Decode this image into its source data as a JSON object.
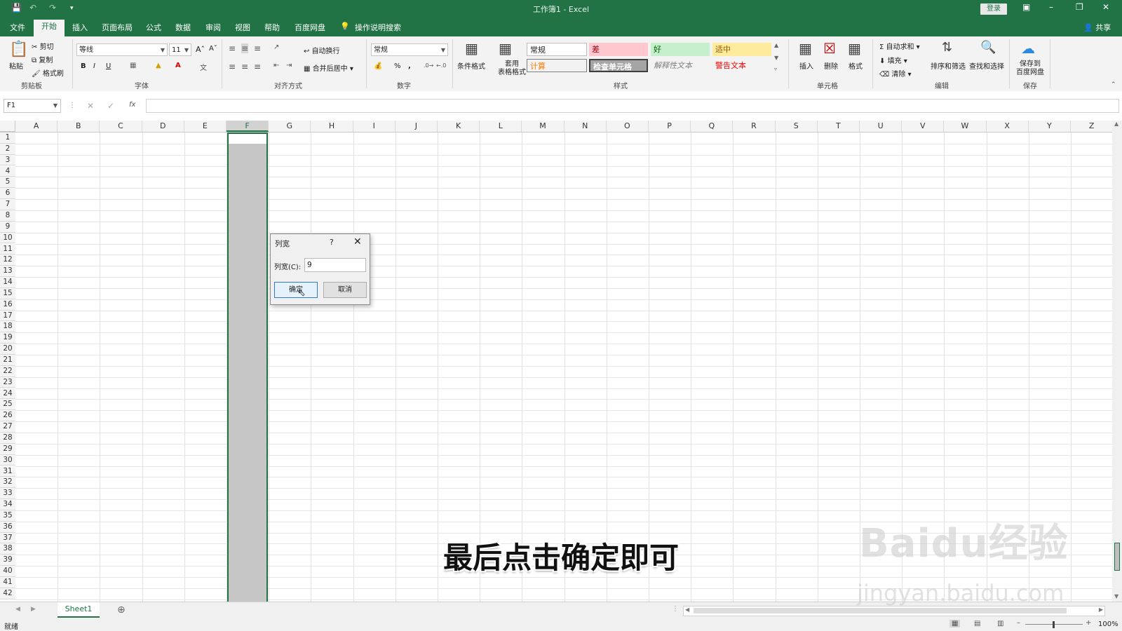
{
  "window": {
    "title": "工作簿1  -  Excel",
    "login": "登录"
  },
  "tabs": [
    "文件",
    "开始",
    "插入",
    "页面布局",
    "公式",
    "数据",
    "审阅",
    "视图",
    "帮助",
    "百度网盘",
    "操作说明搜索"
  ],
  "ribbon": {
    "clipboard": {
      "paste": "粘贴",
      "cut": "剪切",
      "copy": "复制",
      "painter": "格式刷",
      "label": "剪贴板"
    },
    "font": {
      "name": "等线",
      "size": "11",
      "label": "字体"
    },
    "align": {
      "wrap": "自动换行",
      "merge": "合并后居中",
      "label": "对齐方式"
    },
    "number": {
      "format": "常规",
      "label": "数字"
    },
    "styles": {
      "cond": "条件格式",
      "table": "套用\n表格格式",
      "normal": "常规",
      "bad": "差",
      "good": "好",
      "neutral": "适中",
      "calc": "计算",
      "check": "检查单元格",
      "explain": "解释性文本",
      "warn": "警告文本",
      "label": "样式"
    },
    "cells": {
      "insert": "插入",
      "delete": "删除",
      "format": "格式",
      "label": "单元格"
    },
    "edit": {
      "autosum": "自动求和",
      "fill": "填充",
      "clear": "清除",
      "sort": "排序和筛选",
      "find": "查找和选择",
      "label": "编辑"
    },
    "save": {
      "btn": "保存到\n百度网盘",
      "label": "保存"
    },
    "share": "共享"
  },
  "formula": {
    "namebox": "F1",
    "fx": "fx"
  },
  "columns": [
    "A",
    "B",
    "C",
    "D",
    "E",
    "F",
    "G",
    "H",
    "I",
    "J",
    "K",
    "L",
    "M",
    "N",
    "O",
    "P",
    "Q",
    "R",
    "S",
    "T",
    "U",
    "V",
    "W",
    "X",
    "Y",
    "Z"
  ],
  "row_count": 42,
  "sheet": {
    "name": "Sheet1"
  },
  "status": {
    "ready": "就绪",
    "zoom": "100%"
  },
  "dialog": {
    "title": "列宽",
    "help": "?",
    "label": "列宽(C):",
    "value": "9",
    "ok": "确定",
    "cancel": "取消"
  },
  "subtitle": "最后点击确定即可",
  "watermark": "Baidu经验",
  "watermark_url": "jingyan.baidu.com"
}
